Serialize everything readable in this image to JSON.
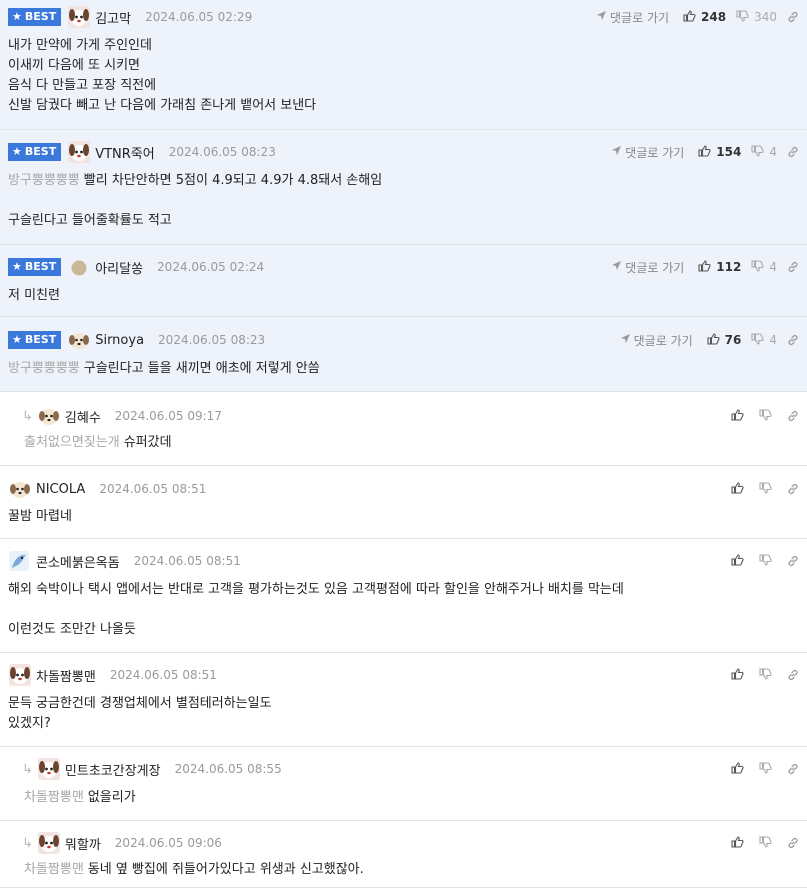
{
  "labels": {
    "best": "BEST",
    "goto": "댓글로 가기"
  },
  "colors": {
    "best_badge": "#3a78dc",
    "best_bg": "#eef2fa",
    "mention": "#a8a8a8"
  },
  "comments": [
    {
      "best": true,
      "avatar": "dog-avatar",
      "nick": "김고막",
      "date": "2024.06.05 02:29",
      "up": "248",
      "down": "340",
      "mention": "",
      "lines": [
        "내가 만약에 가게 주인인데",
        "이새끼 다음에 또 시키면",
        "음식 다 만들고 포장 직전에",
        "신발 담궜다 빼고 난 다음에 가래침 존나게 뱉어서 보낸다"
      ]
    },
    {
      "best": true,
      "avatar": "dog-avatar",
      "nick": "VTNR죽어",
      "date": "2024.06.05 08:23",
      "up": "154",
      "down": "4",
      "mention": "방구뿡뿡뿡뿡",
      "lines": [
        "빨리 차단안하면 5점이 4.9되고 4.9가 4.8돼서 손해임",
        "",
        "구슬린다고 들어줄확률도 적고"
      ]
    },
    {
      "best": true,
      "avatar": "dot-avatar",
      "nick": "아리달쏭",
      "date": "2024.06.05 02:24",
      "up": "112",
      "down": "4",
      "mention": "",
      "lines": [
        "저 미친련"
      ]
    },
    {
      "best": true,
      "avatar": "puppy-avatar",
      "nick": "Sirnoya",
      "date": "2024.06.05 08:23",
      "up": "76",
      "down": "4",
      "mention": "방구뿡뿡뿡뿡",
      "lines": [
        "구슬린다고 들을 새끼면 애초에 저렇게 안씀"
      ]
    },
    {
      "best": false,
      "reply": true,
      "avatar": "puppy-avatar",
      "nick": "김혜수",
      "date": "2024.06.05 09:17",
      "up": "",
      "down": "",
      "mention": "출처없으면짖는개",
      "lines": [
        "슈퍼갔데"
      ]
    },
    {
      "best": false,
      "avatar": "puppy-avatar",
      "nick": "NICOLA",
      "date": "2024.06.05 08:51",
      "up": "",
      "down": "",
      "mention": "",
      "lines": [
        "꿀밤 마렵네"
      ]
    },
    {
      "best": false,
      "avatar": "bird-avatar",
      "nick": "콘소메붉은옥돔",
      "date": "2024.06.05 08:51",
      "up": "",
      "down": "",
      "mention": "",
      "lines": [
        "해외 숙박이나 택시 앱에서는 반대로 고객을 평가하는것도 있음 고객평점에 따라 할인을 안해주거나 배치를 막는데",
        "",
        "이런것도 조만간 나올듯"
      ]
    },
    {
      "best": false,
      "avatar": "dog-avatar",
      "nick": "차돌짬뽕맨",
      "date": "2024.06.05 08:51",
      "up": "",
      "down": "",
      "mention": "",
      "lines": [
        "문득 궁금한건데 경쟁업체에서 별점테러하는일도",
        "있겠지?"
      ]
    },
    {
      "best": false,
      "reply": true,
      "avatar": "dog-avatar",
      "nick": "민트초코간장게장",
      "date": "2024.06.05 08:55",
      "up": "",
      "down": "",
      "mention": "차돌짬뽕맨",
      "lines": [
        "없을리가"
      ]
    },
    {
      "best": false,
      "reply": true,
      "avatar": "dog-avatar",
      "nick": "뭐할까",
      "date": "2024.06.05 09:06",
      "up": "",
      "down": "",
      "mention": "차돌짬뽕맨",
      "lines": [
        "동네 옆 빵집에 쥐들어가있다고 위생과 신고했잖아."
      ]
    }
  ]
}
